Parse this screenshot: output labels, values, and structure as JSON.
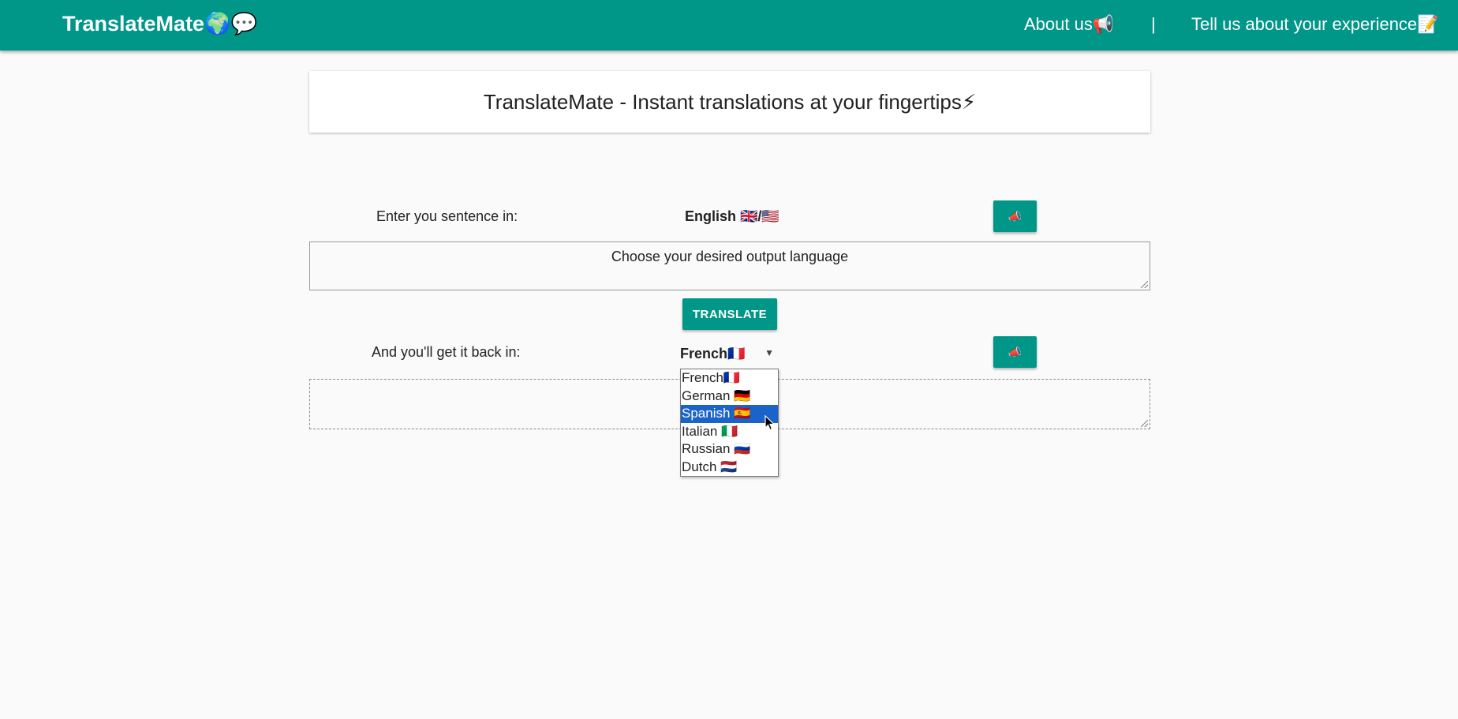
{
  "navbar": {
    "brand": "TranslateMate🌍💬",
    "about_label": "About us📢",
    "separator": "|",
    "feedback_label": "Tell us about your experience📝"
  },
  "header": {
    "title": "TranslateMate - Instant translations at your fingertips⚡"
  },
  "input_section": {
    "label": "Enter you sentence in:",
    "language": "English 🇬🇧/🇺🇸",
    "speak_icon": "📣",
    "textarea_value": "Choose your desired output language"
  },
  "translate_button": {
    "label": "TRANSLATE"
  },
  "output_section": {
    "label": "And you'll get it back in:",
    "selected_language": "French🇫🇷",
    "caret": "▼",
    "speak_icon": "📣",
    "textarea_value": ""
  },
  "language_options": [
    {
      "label": "French🇫🇷",
      "highlighted": false
    },
    {
      "label": "German 🇩🇪",
      "highlighted": false
    },
    {
      "label": "Spanish 🇪🇸",
      "highlighted": true
    },
    {
      "label": "Italian 🇮🇹",
      "highlighted": false
    },
    {
      "label": "Russian 🇷🇺",
      "highlighted": false
    },
    {
      "label": "Dutch 🇳🇱",
      "highlighted": false
    }
  ],
  "colors": {
    "primary": "#009688",
    "background": "#fafafa",
    "highlight": "#1a63c9"
  }
}
